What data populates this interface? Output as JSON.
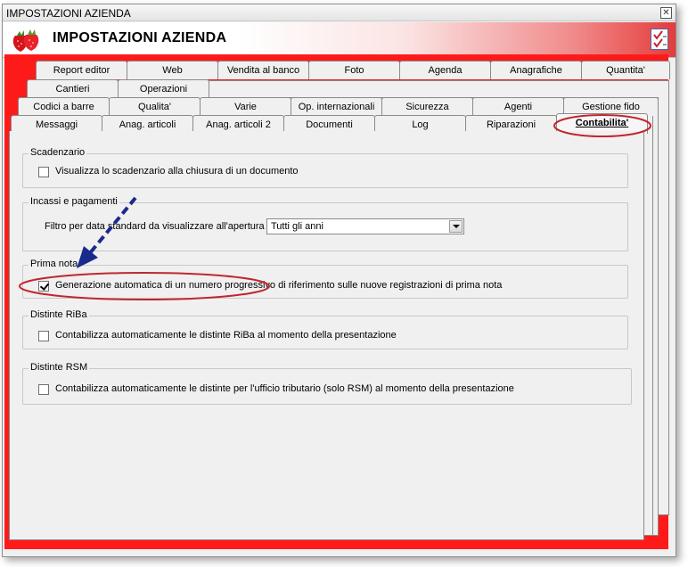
{
  "window": {
    "title": "IMPOSTAZIONI AZIENDA",
    "close_symbol": "✕",
    "heading": "IMPOSTAZIONI AZIENDA",
    "logo_icon": "strawberries-icon",
    "confirm_icon": "checklist-icon"
  },
  "tabs": {
    "row1": [
      "Report editor",
      "Web",
      "Vendita al banco",
      "Foto",
      "Agenda",
      "Anagrafiche",
      "Quantita'"
    ],
    "row2": [
      "Cantieri",
      "Operazioni"
    ],
    "row3": [
      "Codici a barre",
      "Qualita'",
      "Varie",
      "Op. internazionali",
      "Sicurezza",
      "Agenti",
      "Gestione fido"
    ],
    "row4": [
      "Messaggi",
      "Anag. articoli",
      "Anag. articoli 2",
      "Documenti",
      "Log",
      "Riparazioni",
      "Contabilita'"
    ],
    "active": "Contabilita'"
  },
  "scadenzario": {
    "legend": "Scadenzario",
    "option": "Visualizza lo scadenzario alla chiusura di un documento",
    "checked": false
  },
  "incassi": {
    "legend": "Incassi e pagamenti",
    "filter_label": "Filtro per data standard da visualizzare all'apertura :",
    "filter_value": "Tutti gli anni"
  },
  "prima_nota": {
    "legend": "Prima nota",
    "option": "Generazione automatica di un numero progressivo di riferimento sulle nuove registrazioni di prima nota",
    "checked": true
  },
  "riba": {
    "legend": "Distinte RiBa",
    "option": "Contabilizza automaticamente le distinte RiBa al momento della presentazione",
    "checked": false
  },
  "rsm": {
    "legend": "Distinte RSM",
    "option": "Contabilizza automaticamente le distinte per l'ufficio tributario (solo RSM) al momento della presentazione",
    "checked": false
  },
  "colors": {
    "accent_red": "#ff1a1a",
    "annotation_red": "#c0272d",
    "annotation_arrow": "#1a2a8c"
  }
}
